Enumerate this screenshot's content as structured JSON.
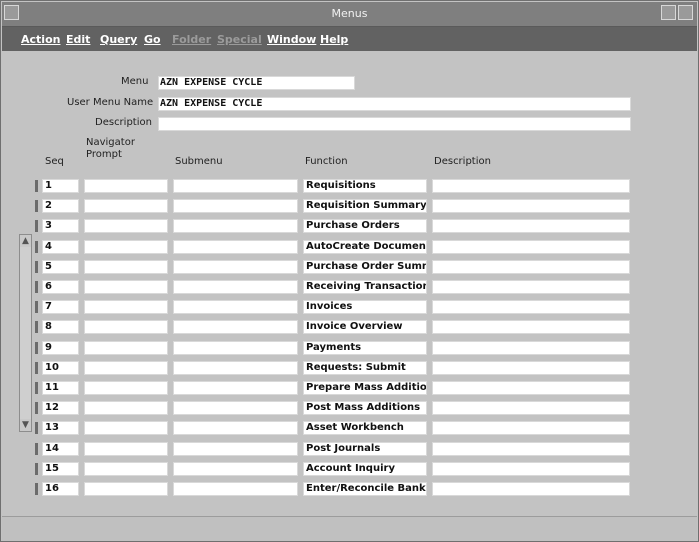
{
  "window": {
    "title": "Menus"
  },
  "menu": {
    "items": [
      {
        "label": "Action",
        "disabled": false
      },
      {
        "label": "Edit",
        "disabled": false
      },
      {
        "label": "Query",
        "disabled": false
      },
      {
        "label": "Go",
        "disabled": false
      },
      {
        "label": "Folder",
        "disabled": true
      },
      {
        "label": "Special",
        "disabled": true
      },
      {
        "label": "Window",
        "disabled": false
      },
      {
        "label": "Help",
        "disabled": false
      }
    ]
  },
  "form": {
    "menu_label": "Menu",
    "menu_value": "AZN EXPENSE CYCLE",
    "user_menu_name_label": "User Menu Name",
    "user_menu_name_value": "AZN EXPENSE CYCLE",
    "description_label": "Description",
    "description_value": ""
  },
  "table": {
    "headers": {
      "seq": "Seq",
      "navigator_prompt": "Navigator Prompt",
      "submenu": "Submenu",
      "function": "Function",
      "description": "Description"
    },
    "rows": [
      {
        "seq": "1",
        "function": "Requisitions"
      },
      {
        "seq": "2",
        "function": "Requisition Summary"
      },
      {
        "seq": "3",
        "function": "Purchase Orders"
      },
      {
        "seq": "4",
        "function": "AutoCreate Documents"
      },
      {
        "seq": "5",
        "function": "Purchase Order Summar"
      },
      {
        "seq": "6",
        "function": "Receiving Transactions"
      },
      {
        "seq": "7",
        "function": "Invoices"
      },
      {
        "seq": "8",
        "function": "Invoice Overview"
      },
      {
        "seq": "9",
        "function": "Payments"
      },
      {
        "seq": "10",
        "function": "Requests: Submit"
      },
      {
        "seq": "11",
        "function": "Prepare Mass Additions"
      },
      {
        "seq": "12",
        "function": "Post Mass Additions"
      },
      {
        "seq": "13",
        "function": "Asset Workbench"
      },
      {
        "seq": "14",
        "function": "Post Journals"
      },
      {
        "seq": "15",
        "function": "Account Inquiry"
      },
      {
        "seq": "16",
        "function": "Enter/Reconcile Bank Sta"
      }
    ]
  },
  "icons": {
    "scroll_up": "up-arrow-icon",
    "scroll_down": "down-arrow-icon"
  }
}
